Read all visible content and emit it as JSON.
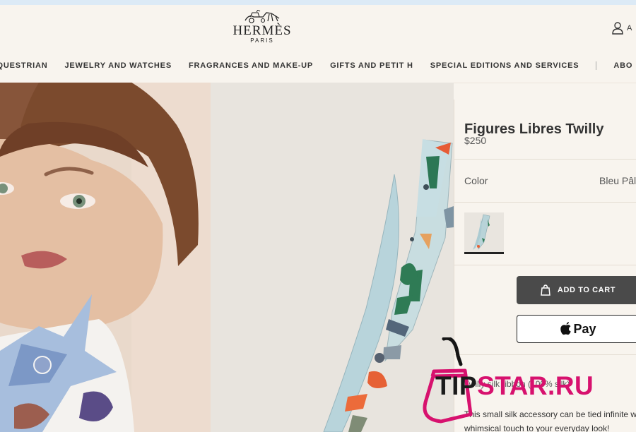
{
  "browser": {
    "top_strip_color": "#dceaf6"
  },
  "brand": {
    "name": "HERMÈS",
    "city": "PARIS"
  },
  "account": {
    "label": "A",
    "icon": "user-icon"
  },
  "nav": {
    "items": [
      "ND EQUESTRIAN",
      "JEWELRY AND WATCHES",
      "FRAGRANCES AND MAKE-UP",
      "GIFTS AND PETIT H",
      "SPECIAL EDITIONS AND SERVICES",
      "ABO"
    ]
  },
  "product": {
    "title": "Figures Libres Twilly",
    "price": "$250",
    "color_label": "Color",
    "color_value": "Bleu Pâle",
    "add_to_cart_label": "ADD TO CART",
    "apple_pay_label": "Pay",
    "description_1": "Twilly silk ribbon (100% silk)",
    "description_2": "This small silk accessory can be tied infinite w whimsical touch to your everyday look!"
  },
  "watermark": {
    "prefix": "TIP",
    "suffix": "STAR.RU",
    "brand_color": "#d7116e"
  },
  "colors": {
    "page_bg": "#f8f4ee",
    "cart_button_bg": "#4a4a4a",
    "scarf_light_blue": "#b9d7df",
    "scarf_green": "#2f7b55"
  }
}
